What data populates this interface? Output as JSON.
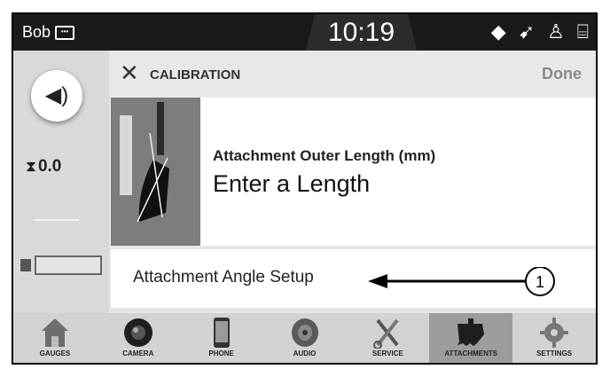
{
  "status_bar": {
    "user": "Bob",
    "time": "10:19"
  },
  "left_panel": {
    "timer_value": "0.0"
  },
  "header": {
    "title": "CALIBRATION",
    "done_label": "Done"
  },
  "attachment_length": {
    "label": "Attachment Outer Length (mm)",
    "value": "Enter a Length"
  },
  "angle_setup": {
    "label": "Attachment Angle Setup",
    "callout": "1"
  },
  "nav": {
    "items": [
      {
        "label": "GAUGES",
        "icon": "house-icon"
      },
      {
        "label": "CAMERA",
        "icon": "camera-icon"
      },
      {
        "label": "PHONE",
        "icon": "phone-icon"
      },
      {
        "label": "AUDIO",
        "icon": "speaker-icon"
      },
      {
        "label": "SERVICE",
        "icon": "wrench-icon"
      },
      {
        "label": "ATTACHMENTS",
        "icon": "bucket-icon",
        "active": true
      },
      {
        "label": "SETTINGS",
        "icon": "gear-icon"
      }
    ]
  }
}
